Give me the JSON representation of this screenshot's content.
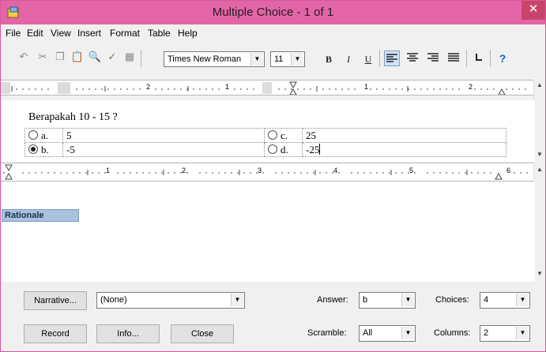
{
  "window": {
    "title": "Multiple Choice - 1 of 1",
    "close_glyph": "✕"
  },
  "menu": [
    "File",
    "Edit",
    "View",
    "Insert",
    "Format",
    "Table",
    "Help"
  ],
  "toolbar": {
    "font_name": "Times New Roman",
    "font_size": "11",
    "bold": "B",
    "italic": "I",
    "underline": "U",
    "help": "?"
  },
  "ruler1_numbers": [
    "2",
    "1",
    "1",
    "2"
  ],
  "ruler2_numbers": [
    "1",
    "2",
    "3",
    "4",
    "5",
    "6"
  ],
  "question": {
    "text": "Berapakah 10 - 15 ?"
  },
  "choices": [
    {
      "letter": "a.",
      "text": "5",
      "selected": false
    },
    {
      "letter": "c.",
      "text": "25",
      "selected": false
    },
    {
      "letter": "b.",
      "text": "-5",
      "selected": true
    },
    {
      "letter": "d.",
      "text": "-25",
      "selected": false
    }
  ],
  "rationale": {
    "label": "Rationale"
  },
  "bottom": {
    "narrative_button": "Narrative...",
    "narrative_value": "(None)",
    "answer_label": "Answer:",
    "answer_value": "b",
    "choices_label": "Choices:",
    "choices_value": "4",
    "record_button": "Record",
    "info_button": "Info...",
    "close_button": "Close",
    "scramble_label": "Scramble:",
    "scramble_value": "All",
    "columns_label": "Columns:",
    "columns_value": "2"
  },
  "colors": {
    "titlebar": "#e266a6",
    "rationale_tab": "#a9c3de"
  }
}
